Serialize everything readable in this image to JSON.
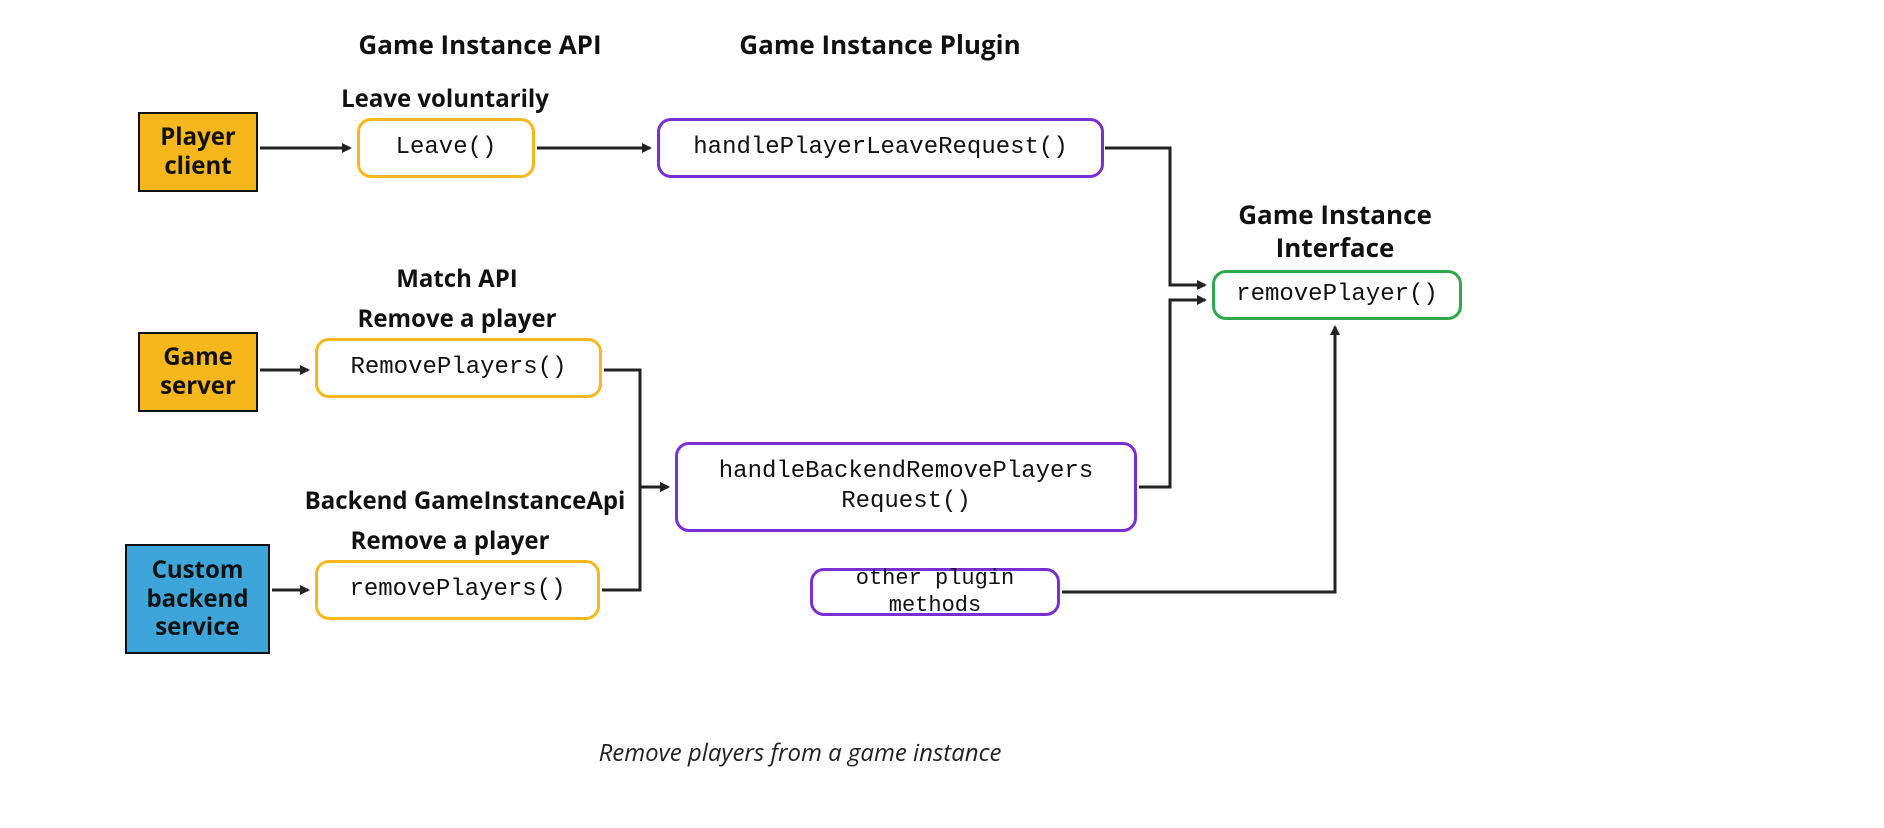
{
  "columns": {
    "api_header": "Game Instance API",
    "plugin_header": "Game Instance Plugin",
    "interface_header": "Game Instance\nInterface"
  },
  "sources": {
    "player_client": "Player\nclient",
    "game_server": "Game\nserver",
    "custom_backend": "Custom\nbackend\nservice"
  },
  "api_labels": {
    "leave_sub": "Leave voluntarily",
    "leave_fn": "Leave()",
    "match_api_header": "Match API",
    "remove_player_sub": "Remove a player",
    "remove_players_fn": "RemovePlayers()",
    "backend_api_header": "Backend GameInstanceApi",
    "remove_player_sub2": "Remove a player",
    "remove_players_fn2": "removePlayers()"
  },
  "plugin_labels": {
    "handle_leave": "handlePlayerLeaveRequest()",
    "handle_backend_remove": "handleBackendRemovePlayers\nRequest()",
    "other_methods": "other plugin methods"
  },
  "interface_labels": {
    "remove_player_fn": "removePlayer()"
  },
  "caption": "Remove players from a game instance",
  "colors": {
    "amber": "#f5b71b",
    "blue": "#3ea5db",
    "purple": "#7a2ed6",
    "green": "#2fa84a",
    "arrow": "#222222"
  }
}
